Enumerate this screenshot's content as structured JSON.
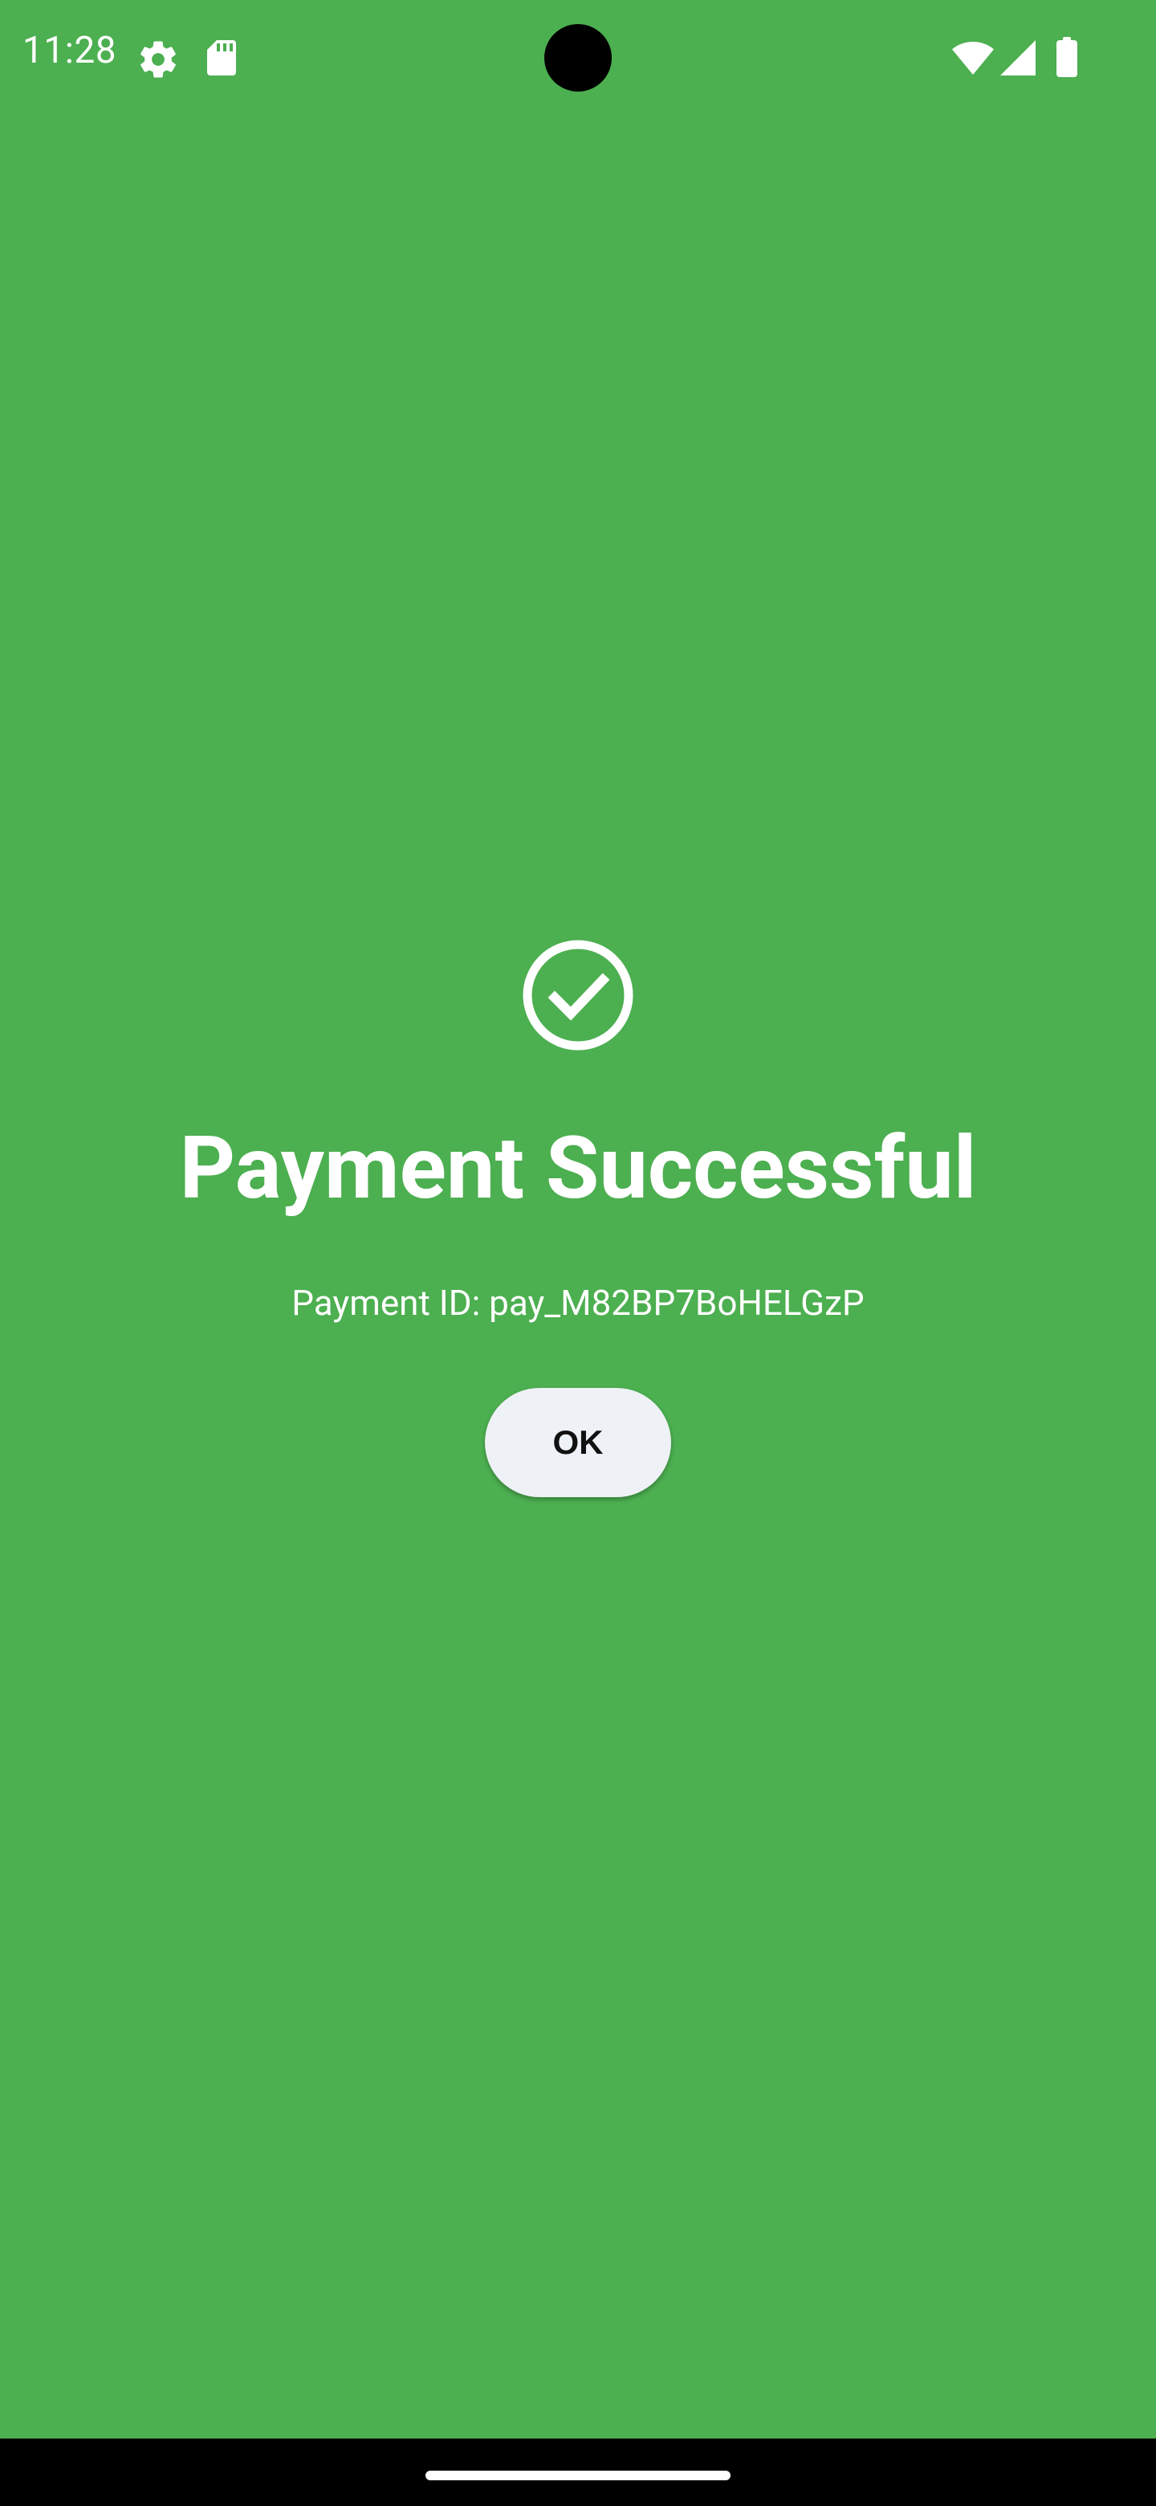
{
  "status_bar": {
    "time": "11:28",
    "icons": [
      "gear-icon",
      "sd-card-icon",
      "wifi-icon",
      "cell-signal-icon",
      "battery-icon"
    ]
  },
  "main": {
    "status_icon": "check-circle-icon",
    "title": "Payment Successful",
    "payment_id": "Payment ID: pay_M82BP7BoHELGzP",
    "ok_label": "OK"
  },
  "colors": {
    "background": "#4CAF50",
    "text": "#FFFFFF",
    "button_bg": "#EEF1F6",
    "button_text": "#111111",
    "nav_bar": "#000000"
  }
}
